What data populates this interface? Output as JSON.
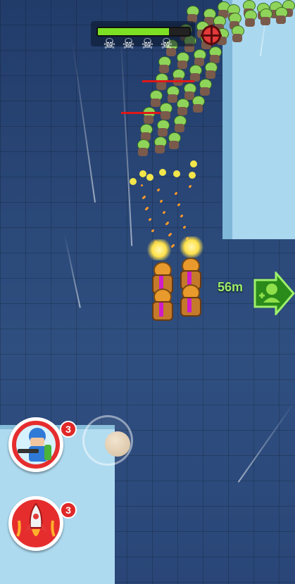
{
  "hud": {
    "health_fraction": 0.78,
    "health_color": "#7de024",
    "skulls": [
      "skull-icon",
      "skull-icon",
      "skull-icon",
      "skull-icon"
    ],
    "skull_glyph": "☠",
    "target_icon": "crosshair-icon"
  },
  "objective": {
    "distance": "56m",
    "icon": "add-ally-arrow-icon",
    "color": "#3fcf2a"
  },
  "abilities": [
    {
      "name": "soldier-ability",
      "icon": "soldier-icon",
      "count": "3"
    },
    {
      "name": "rocket-ability",
      "icon": "rocket-icon",
      "count": "3"
    }
  ],
  "colors": {
    "floor": "#2c4a7a",
    "wall": "#a9d8ef",
    "zombie_skin": "#8fd45a",
    "hero_armor": "#e89a2c",
    "ability_ring": "#e62d2d"
  }
}
